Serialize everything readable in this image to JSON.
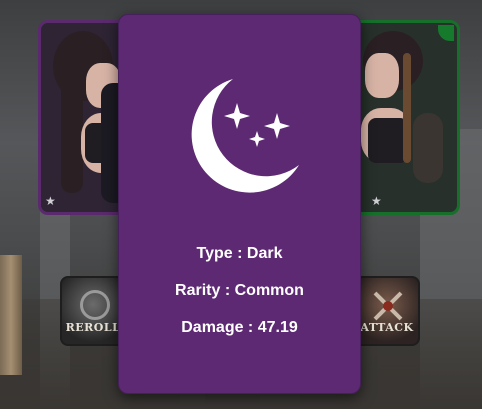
{
  "card": {
    "type_line": "Type : Dark",
    "rarity_line": "Rarity : Common",
    "damage_line": "Damage : 47.19",
    "color": "#5d2973",
    "icon": "crescent-moon-stars-icon"
  },
  "buttons": {
    "reroll_label": "REROLL",
    "attack_label": "ATTACK"
  },
  "side_cards": {
    "left_border": "#5b2a6e",
    "right_border": "#16702a"
  }
}
